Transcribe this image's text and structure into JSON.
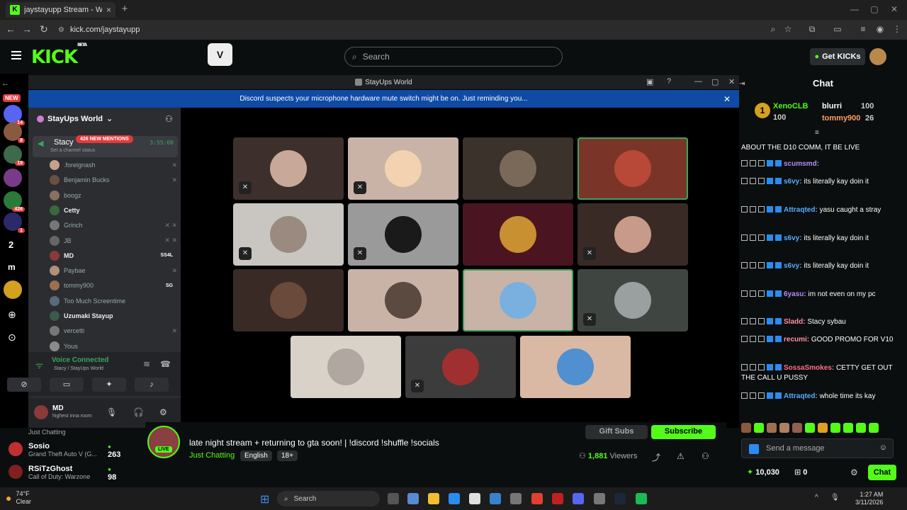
{
  "browser": {
    "tab_title": "jaystayupp Stream - Watch Live",
    "tab_close": "×",
    "new_tab": "+",
    "url": "kick.com/jaystayupp"
  },
  "kick": {
    "logo": "KICK",
    "logo_badge": "BETA",
    "search_placeholder": "Search",
    "get_kicks": "Get KICKs",
    "rail_new": "NEW",
    "rail_badges": [
      "14",
      "8",
      "19",
      "426",
      "4",
      "1",
      "2",
      "1"
    ],
    "suggested": [
      {
        "name": "Just Chatting",
        "category": "",
        "count": ""
      },
      {
        "name": "Sosio",
        "category": "Grand Theft Auto V (G...",
        "count": "263"
      },
      {
        "name": "RSiTzGhost",
        "category": "Call of Duty: Warzone",
        "count": "98"
      }
    ],
    "stream": {
      "title": "late night stream + returning to gta soon! | !discord !shuffle !socials",
      "category": "Just Chatting",
      "tags": [
        "English",
        "18+"
      ],
      "viewers": "1,881",
      "viewers_label": "Viewers",
      "live": "LIVE",
      "gift_subs": "Gift Subs",
      "subscribe": "Subscribe",
      "channel": "jaystayupp"
    }
  },
  "discord": {
    "window_title": "StayUps World",
    "notice": "Discord suspects your microphone hardware mute switch might be on. Just reminding you...",
    "server_name": "StayUps World",
    "voice_channel": "Stacy",
    "mentions": "426 NEW MENTIONS",
    "channel_status": "Set a channel status",
    "timer": "3:55:00",
    "members": [
      {
        "name": ".foreignash",
        "hi": false,
        "tag": "",
        "muted": "✕"
      },
      {
        "name": "Benjamin Bucks",
        "hi": false,
        "tag": "",
        "muted": "✕"
      },
      {
        "name": "boogz",
        "hi": false,
        "tag": "",
        "muted": ""
      },
      {
        "name": "Cetty",
        "hi": true,
        "tag": "",
        "muted": ""
      },
      {
        "name": "Grinch",
        "hi": false,
        "tag": "",
        "muted": "✕ ✕"
      },
      {
        "name": "JB",
        "hi": false,
        "tag": "",
        "muted": "✕ ✕"
      },
      {
        "name": "MD",
        "hi": true,
        "tag": "SS4L",
        "muted": ""
      },
      {
        "name": "Paybae",
        "hi": false,
        "tag": "",
        "muted": "✕"
      },
      {
        "name": "tommy900",
        "hi": false,
        "tag": "SG",
        "muted": ""
      },
      {
        "name": "Too Much Screentime",
        "hi": false,
        "tag": "",
        "muted": ""
      },
      {
        "name": "Uzumaki Stayup",
        "hi": true,
        "tag": "",
        "muted": ""
      },
      {
        "name": "vercetti",
        "hi": false,
        "tag": "",
        "muted": "✕"
      },
      {
        "name": "Yous",
        "hi": false,
        "tag": "",
        "muted": ""
      }
    ],
    "voice_connected": "Voice Connected",
    "voice_path": "Stacy / StayUps World",
    "user_name": "MD",
    "user_status": "highest inna room"
  },
  "chat": {
    "header": "Chat",
    "top_gifters": [
      {
        "name": "XenoCLB",
        "amount": "100"
      },
      {
        "name": "blurri",
        "amount": "100"
      },
      {
        "name": "tommy900",
        "amount": "26"
      }
    ],
    "messages": [
      {
        "user": "",
        "text": "ABOUT THE D10 COMM, IT BE LIVE",
        "color": "#ffffff"
      },
      {
        "user": "scumsmd:",
        "text": "",
        "color": "#b48cf0"
      },
      {
        "user": "s6vy:",
        "text": "its literally kay doin it",
        "color": "#5aa9ff"
      },
      {
        "user": "Attraqted:",
        "text": "yasu caught a stray",
        "color": "#5aa9ff"
      },
      {
        "user": "s6vy:",
        "text": "its literally kay doin it",
        "color": "#5aa9ff"
      },
      {
        "user": "s6vy:",
        "text": "its literally kay doin it",
        "color": "#5aa9ff"
      },
      {
        "user": "6yasu:",
        "text": "im not even on my pc",
        "color": "#b48cf0"
      },
      {
        "user": "Sladd:",
        "text": "Stacy sybau",
        "color": "#ff8fa0"
      },
      {
        "user": "recumi:",
        "text": "GOOD PROMO FOR V10",
        "color": "#ff8fa0"
      },
      {
        "user": "SossaSmokes:",
        "text": "CETTY GET OUT THE CALL U PUSSY",
        "color": "#ff6f8a"
      },
      {
        "user": "Attraqted:",
        "text": "whole time its kay",
        "color": "#5aa9ff"
      }
    ],
    "placeholder": "Send a message",
    "points": "10,030",
    "points2": "0",
    "send": "Chat"
  },
  "taskbar": {
    "temp": "74°F",
    "weather": "Clear",
    "search": "Search",
    "time": "1:27 AM",
    "date": "3/11/2026"
  }
}
